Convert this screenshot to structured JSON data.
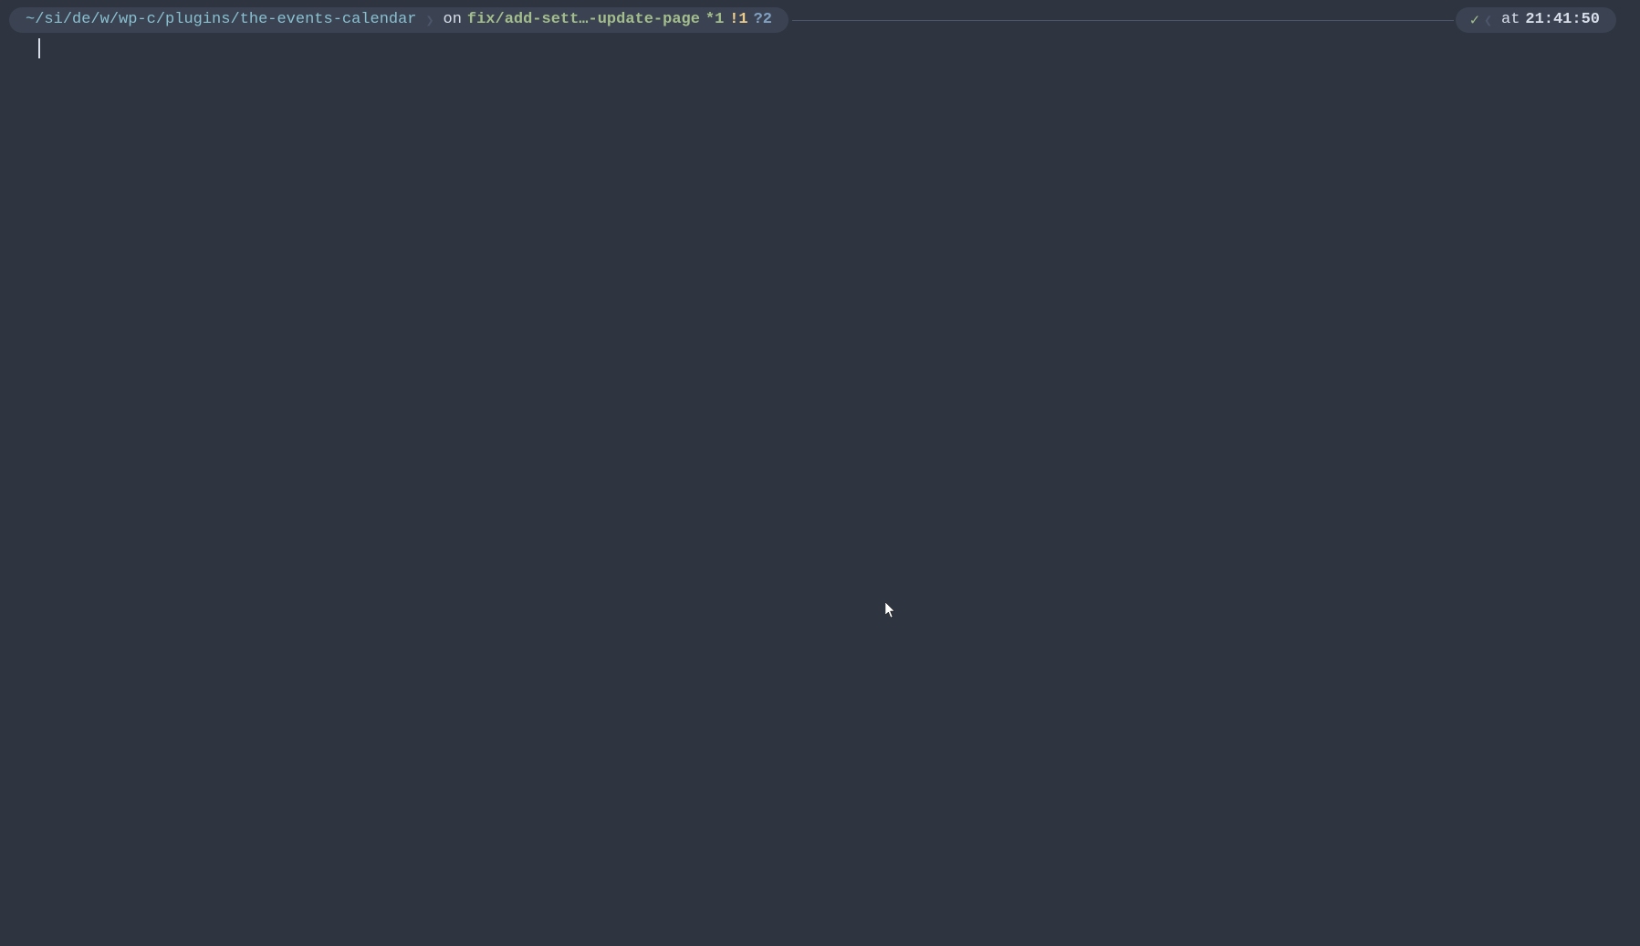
{
  "prompt": {
    "path": {
      "tilde": "~",
      "seg1": "si",
      "seg2": "de",
      "seg3": "w",
      "seg4": "wp-c",
      "seg5": "plugins",
      "final": "the-events-calendar",
      "sep": "/"
    },
    "on": "on",
    "branch": "fix/add-sett…-update-page",
    "git_star": "*1",
    "git_bang": "!1",
    "git_question": "?2",
    "check": "✓",
    "at": "at",
    "time": "21:41:50"
  }
}
